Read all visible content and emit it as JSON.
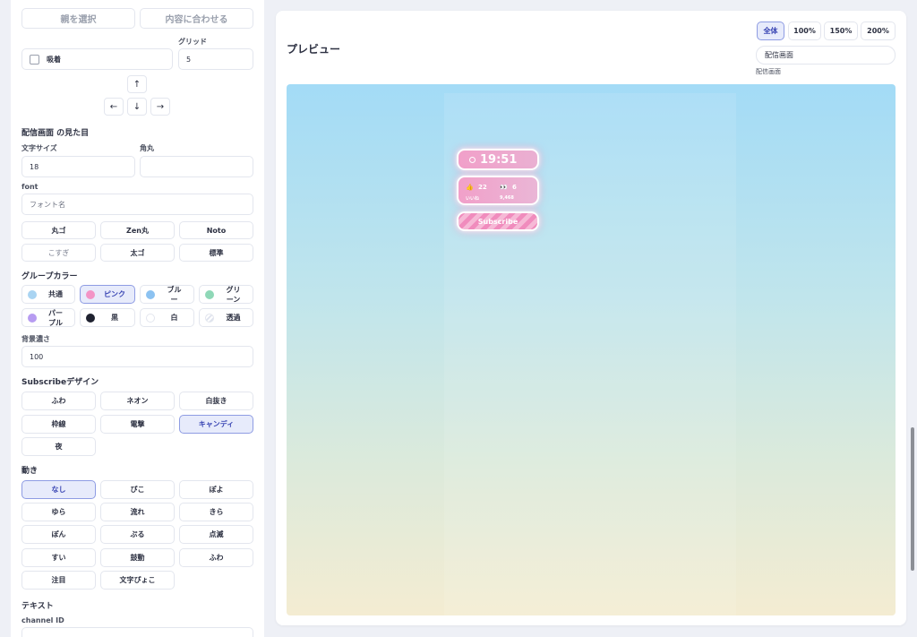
{
  "controls": {
    "select_parent": "親を選択",
    "fit_content": "内容に合わせる",
    "snap_label": "吸着",
    "grid_label": "グリッド",
    "grid_value": "5",
    "arrows": {
      "up": "↑",
      "left": "←",
      "down": "↓",
      "right": "→"
    }
  },
  "appearance": {
    "section": "配信画面 の見た目",
    "font_size_label": "文字サイズ",
    "font_size_value": "18",
    "corner_label": "角丸",
    "corner_value": "",
    "font_label": "font",
    "font_placeholder": "フォント名",
    "font_presets": [
      "丸ゴ",
      "Zen丸",
      "Noto",
      "こすぎ",
      "太ゴ",
      "標準"
    ]
  },
  "group_color": {
    "section": "グループカラー",
    "options": [
      {
        "label": "共通",
        "color": "#a9d4f2"
      },
      {
        "label": "ピンク",
        "color": "#f394c6"
      },
      {
        "label": "ブルー",
        "color": "#8cc2f1"
      },
      {
        "label": "グリーン",
        "color": "#8fd8b7"
      },
      {
        "label": "パープル",
        "color": "#b79cf1"
      },
      {
        "label": "黒",
        "color": "#1f2230"
      },
      {
        "label": "白",
        "color": "#ffffff"
      },
      {
        "label": "透過",
        "color": "#dfe3ee"
      }
    ],
    "selected": "ピンク"
  },
  "bg_opacity": {
    "label": "背景濃さ",
    "value": "100"
  },
  "subscribe_design": {
    "section": "Subscribeデザイン",
    "options": [
      "ふわ",
      "ネオン",
      "白抜き",
      "枠線",
      "電撃",
      "キャンディ",
      "夜"
    ],
    "selected": "キャンディ"
  },
  "motion": {
    "section": "動き",
    "options": [
      "なし",
      "ぴこ",
      "ぽよ",
      "ゆら",
      "流れ",
      "きら",
      "ぽん",
      "ぷる",
      "点滅",
      "すい",
      "鼓動",
      "ふわ",
      "注目",
      "文字ぴょこ"
    ],
    "selected": "なし"
  },
  "text": {
    "section": "テキスト",
    "channel_label": "channel ID"
  },
  "preview": {
    "title": "プレビュー",
    "zoom_options": [
      "全体",
      "100%",
      "150%",
      "200%"
    ],
    "zoom_selected": "全体",
    "scene_value": "配信画面",
    "scene_caption": "配信画面"
  },
  "widgets": {
    "clock": "19:51",
    "likes": "22",
    "viewers": "6",
    "likes_caption": "いいね",
    "viewers_caption": "9,468",
    "subscribe": "Subscribe"
  }
}
